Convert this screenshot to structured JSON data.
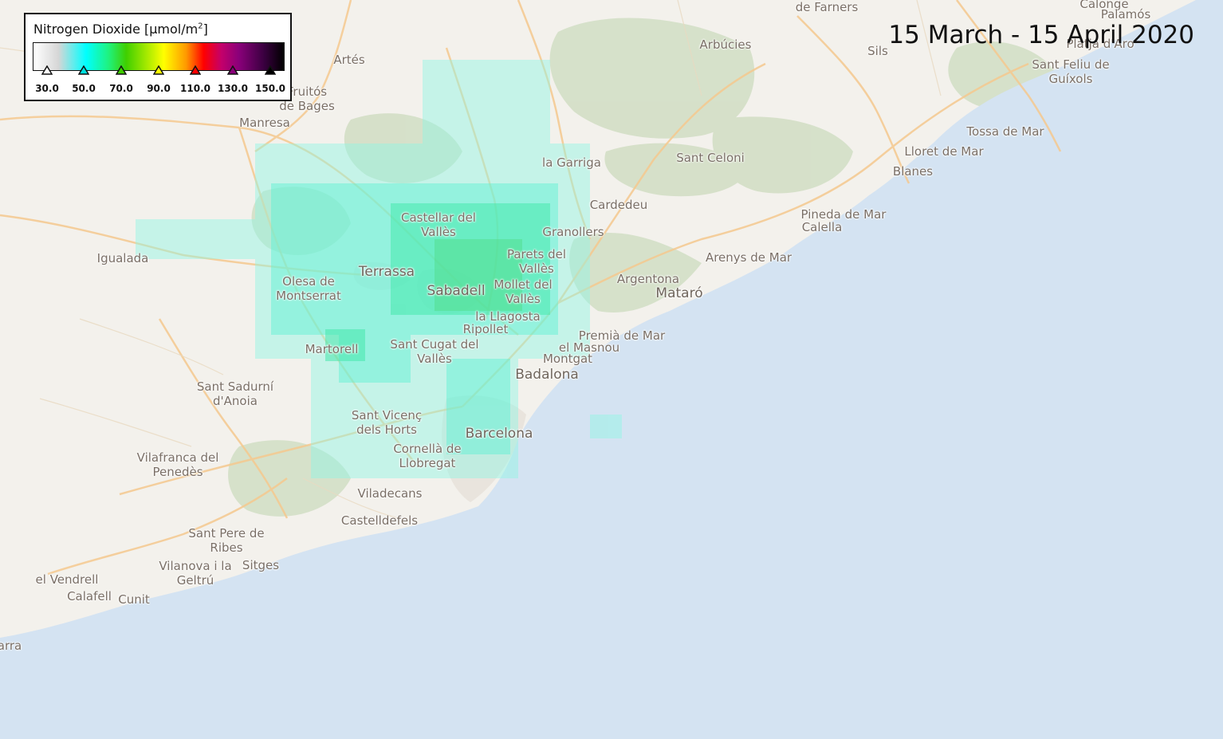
{
  "date_range": "15 March - 15 April 2020",
  "legend": {
    "title_prefix": "Nitrogen Dioxide [µmol/m",
    "title_sup": "2",
    "title_suffix": "]",
    "ticks": [
      {
        "label": "30.0",
        "color": "#ffffff"
      },
      {
        "label": "50.0",
        "color": "#00e0e0"
      },
      {
        "label": "70.0",
        "color": "#3fcf00"
      },
      {
        "label": "90.0",
        "color": "#ffff00"
      },
      {
        "label": "110.0",
        "color": "#ff0000"
      },
      {
        "label": "130.0",
        "color": "#8a007a"
      },
      {
        "label": "150.0",
        "color": "#000000"
      }
    ]
  },
  "colors": {
    "sea": "#d4e3f2",
    "land": "#f3f1ec",
    "forest": "#cfdcc2",
    "road": "#f5c98f",
    "no2_low": "#00f0d0",
    "no2_mid": "#2ee890"
  },
  "places": [
    {
      "name": "de Farners"
    },
    {
      "name": "Calonge"
    },
    {
      "name": "Palamós"
    },
    {
      "name": "Arbúcies"
    },
    {
      "name": "Sils"
    },
    {
      "name": "Platja d'Aro"
    },
    {
      "name": "Sant Feliu de\nGuíxols"
    },
    {
      "name": "Artés"
    },
    {
      "name": "Fruitós\nde Bages"
    },
    {
      "name": "Manresa"
    },
    {
      "name": "Tossa de Mar"
    },
    {
      "name": "Lloret de Mar"
    },
    {
      "name": "Blanes"
    },
    {
      "name": "Sant Celoni"
    },
    {
      "name": "la Garriga"
    },
    {
      "name": "Cardedeu"
    },
    {
      "name": "Castellar del\nVallès"
    },
    {
      "name": "Granollers"
    },
    {
      "name": "Pineda de Mar"
    },
    {
      "name": "Calella"
    },
    {
      "name": "Igualada"
    },
    {
      "name": "Parets del\nVallès"
    },
    {
      "name": "Arenys de Mar"
    },
    {
      "name": "Terrassa",
      "big": true
    },
    {
      "name": "Olesa de\nMontserrat"
    },
    {
      "name": "Sabadell",
      "big": true
    },
    {
      "name": "Mollet del\nVallès"
    },
    {
      "name": "Argentona"
    },
    {
      "name": "Mataró",
      "big": true
    },
    {
      "name": "la Llagosta"
    },
    {
      "name": "Ripollet"
    },
    {
      "name": "Premià de Mar"
    },
    {
      "name": "Martorell"
    },
    {
      "name": "Sant Cugat del\nVallès"
    },
    {
      "name": "el Masnou"
    },
    {
      "name": "Montgat"
    },
    {
      "name": "Badalona",
      "big": true
    },
    {
      "name": "Sant Sadurní\nd'Anoia"
    },
    {
      "name": "Sant Vicenç\ndels Horts"
    },
    {
      "name": "Barcelona",
      "big": true
    },
    {
      "name": "Cornellà de\nLlobregat"
    },
    {
      "name": "Vilafranca del\nPenedès"
    },
    {
      "name": "Viladecans"
    },
    {
      "name": "Castelldefels"
    },
    {
      "name": "Sant Pere de\nRibes"
    },
    {
      "name": "Vilanova i la\nGeltrú"
    },
    {
      "name": "Sitges"
    },
    {
      "name": "el Vendrell"
    },
    {
      "name": "Calafell"
    },
    {
      "name": "Cunit"
    },
    {
      "name": "arra"
    }
  ]
}
